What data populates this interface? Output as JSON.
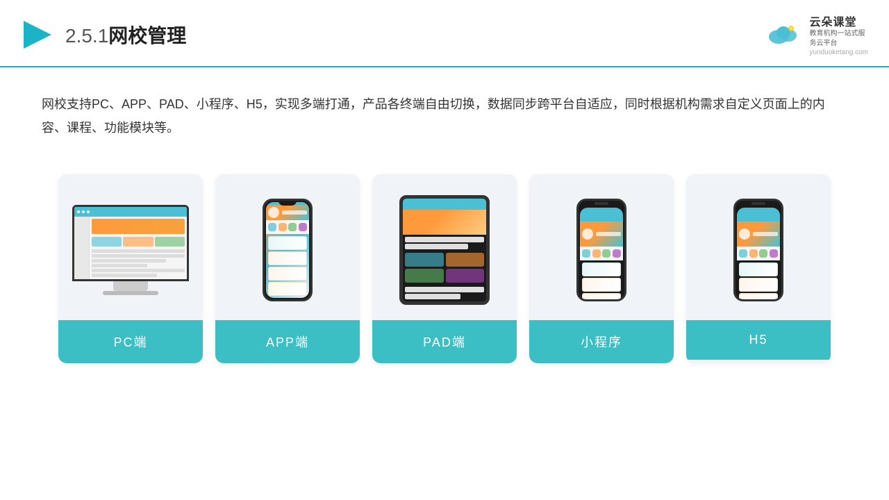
{
  "header": {
    "title": "2.5.1网校管理",
    "title_number": "2.5.1",
    "title_text": "网校管理",
    "logo_name": "云朵课堂",
    "logo_domain": "yunduoketang.com",
    "logo_tagline": "教育机构一站式服务云平台"
  },
  "description": {
    "text": "网校支持PC、APP、PAD、小程序、H5，实现多端打通，产品各终端自由切换，数据同步跨平台自适应，同时根据机构需求自定义页面上的内容、课程、功能模块等。"
  },
  "cards": [
    {
      "id": "pc",
      "label": "PC端"
    },
    {
      "id": "app",
      "label": "APP端"
    },
    {
      "id": "pad",
      "label": "PAD端"
    },
    {
      "id": "miniprogram",
      "label": "小程序"
    },
    {
      "id": "h5",
      "label": "H5"
    }
  ],
  "colors": {
    "accent": "#3bbfc4",
    "header_line": "#1ab3c8",
    "card_bg": "#f0f4f8",
    "card_label_bg": "#3bbfc4"
  }
}
